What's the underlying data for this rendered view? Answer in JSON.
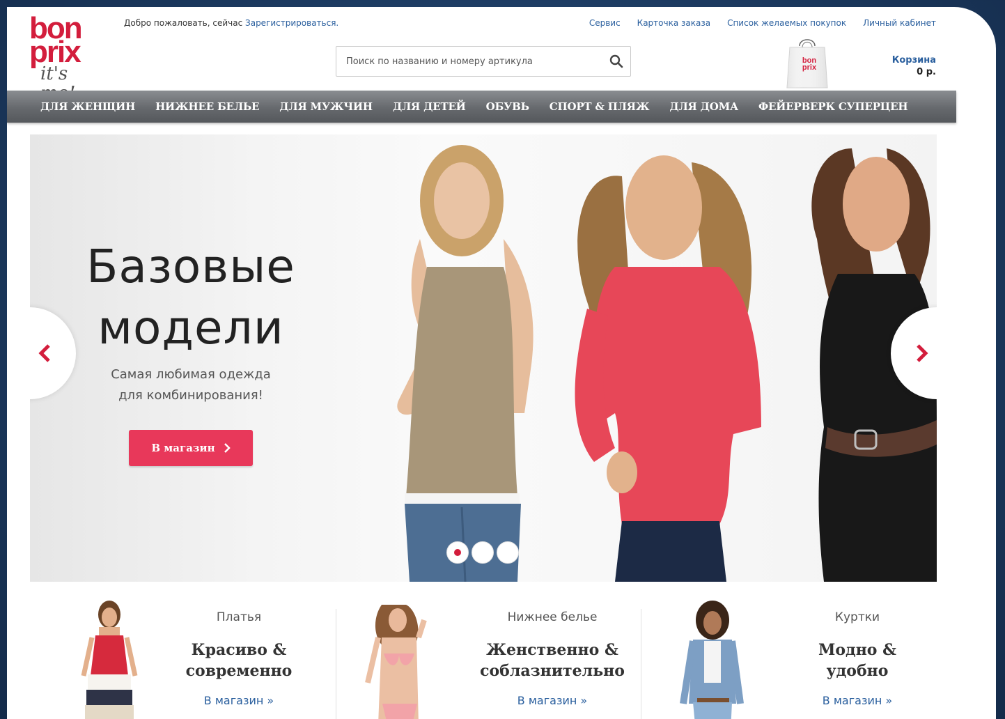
{
  "header": {
    "logo": {
      "line1": "bon",
      "line2": "prix",
      "slogan": "it's me!"
    },
    "welcome_text": "Добро пожаловать, сейчас ",
    "register_link": "Зарегистрироваться.",
    "top_links": [
      "Сервис",
      "Карточка заказа",
      "Список желаемых покупок",
      "Личный кабинет"
    ],
    "search": {
      "placeholder": "Поиск по названию и номеру артикула",
      "icon": "search-icon"
    },
    "cart": {
      "label": "Корзина",
      "sum": "0 р.",
      "bag_logo": "bon prix"
    }
  },
  "nav": {
    "items": [
      "ДЛЯ ЖЕНЩИН",
      "НИЖНЕЕ БЕЛЬЕ",
      "ДЛЯ МУЖЧИН",
      "ДЛЯ ДЕТЕЙ",
      "ОБУВЬ",
      "СПОРТ & ПЛЯЖ",
      "ДЛЯ ДОМА",
      "ФЕЙЕРВЕРК СУПЕРЦЕН"
    ]
  },
  "hero": {
    "title_line1": "Базовые",
    "title_line2": "модели",
    "subtitle_line1": "Самая любимая одежда",
    "subtitle_line2": "для комбинирования!",
    "button": "В магазин",
    "button_icon": "chevron-right-icon",
    "prev_icon": "chevron-left-icon",
    "next_icon": "chevron-right-icon",
    "slides_count": 3,
    "active_slide": 1
  },
  "promos": [
    {
      "category": "Платья",
      "headline_line1": "Красиво &",
      "headline_line2": "современно",
      "link": "В магазин »"
    },
    {
      "category": "Нижнее белье",
      "headline_line1": "Женственно &",
      "headline_line2": "соблазнительно",
      "link": "В магазин »"
    },
    {
      "category": "Куртки",
      "headline_line1": "Модно &",
      "headline_line2": "удобно",
      "link": "В магазин »"
    }
  ],
  "colors": {
    "brand": "#d31d3c",
    "button": "#e8385a",
    "link": "#2a5f9e",
    "nav_bg": "#66696d"
  }
}
